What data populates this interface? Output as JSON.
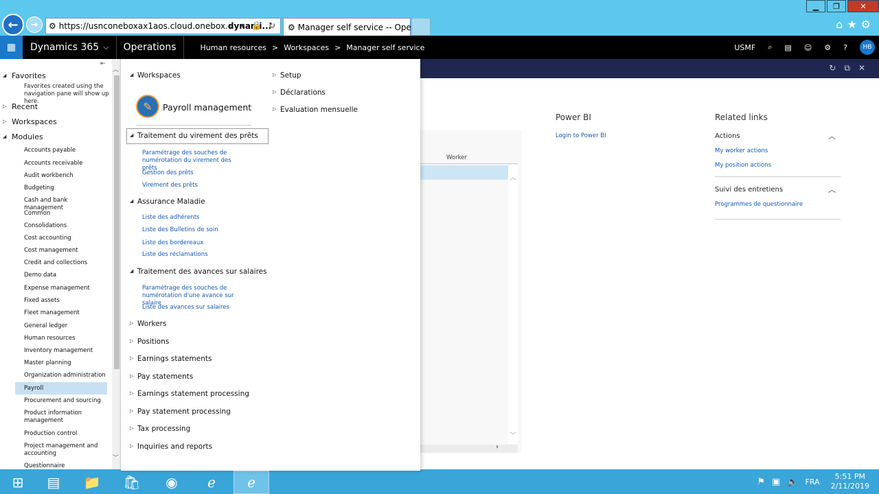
{
  "browser": {
    "url_prefix": "https://usnconeboxax1aos.cloud.onebox.",
    "url_bold": "dynami...",
    "tab_title": "Manager self service -- Ope...",
    "tab_close": "×"
  },
  "navbar": {
    "brand": "Dynamics 365",
    "module": "Operations",
    "breadcrumb": [
      "Human resources",
      ">",
      "Workspaces",
      ">",
      "Manager self service"
    ],
    "company": "USMF",
    "avatar": "HB"
  },
  "navpane": {
    "favorites": "Favorites",
    "favorites_note": "Favorites created using the navigation pane will show up here.",
    "recent": "Recent",
    "workspaces": "Workspaces",
    "modules": "Modules",
    "modules_list": [
      "Accounts payable",
      "Accounts receivable",
      "Audit workbench",
      "Budgeting",
      "Cash and bank management",
      "Common",
      "Consolidations",
      "Cost accounting",
      "Cost management",
      "Credit and collections",
      "Demo data",
      "Expense management",
      "Fixed assets",
      "Fleet management",
      "General ledger",
      "Human resources",
      "Inventory management",
      "Master planning",
      "Organization administration",
      "Payroll",
      "Procurement and sourcing",
      "Product information management",
      "Production control",
      "Project management and accounting",
      "Questionnaire"
    ]
  },
  "flyout": {
    "workspaces": "Workspaces",
    "workspace_title": "Payroll management",
    "group1": "Traitement du virement des prêts",
    "group1_links": [
      "Paramétrage des souches de numérotation du virement des prêts",
      "Gestion des prêts",
      "Virement des prêts"
    ],
    "group2": "Assurance Maladie",
    "group2_links": [
      "Liste des adhérents",
      "Liste des Bulletins de soin",
      "Liste des bordereaux",
      "Liste des réclamations"
    ],
    "group3": "Traitement des avances sur salaires",
    "group3_links": [
      "Paramétrage des souches de numérotation d'une avance sur salaire",
      "Liste des avances sur salaires"
    ],
    "collapsed": [
      "Workers",
      "Positions",
      "Earnings statements",
      "Pay statements",
      "Earnings statement processing",
      "Pay statement processing",
      "Tax processing",
      "Inquiries and reports"
    ],
    "right_col": [
      "Setup",
      "Déclarations",
      "Evaluation mensuelle"
    ]
  },
  "main": {
    "worker_col": "Worker",
    "powerbi_title": "Power BI",
    "powerbi_link": "Login to Power BI",
    "related_title": "Related links",
    "actions_title": "Actions",
    "actions_links": [
      "My worker actions",
      "My position actions"
    ],
    "suivi_title": "Suivi des entretiens",
    "suivi_links": [
      "Programmes de questionnaire"
    ]
  },
  "taskbar": {
    "lang": "FRA",
    "time": "5:51 PM",
    "date": "2/11/2019"
  }
}
